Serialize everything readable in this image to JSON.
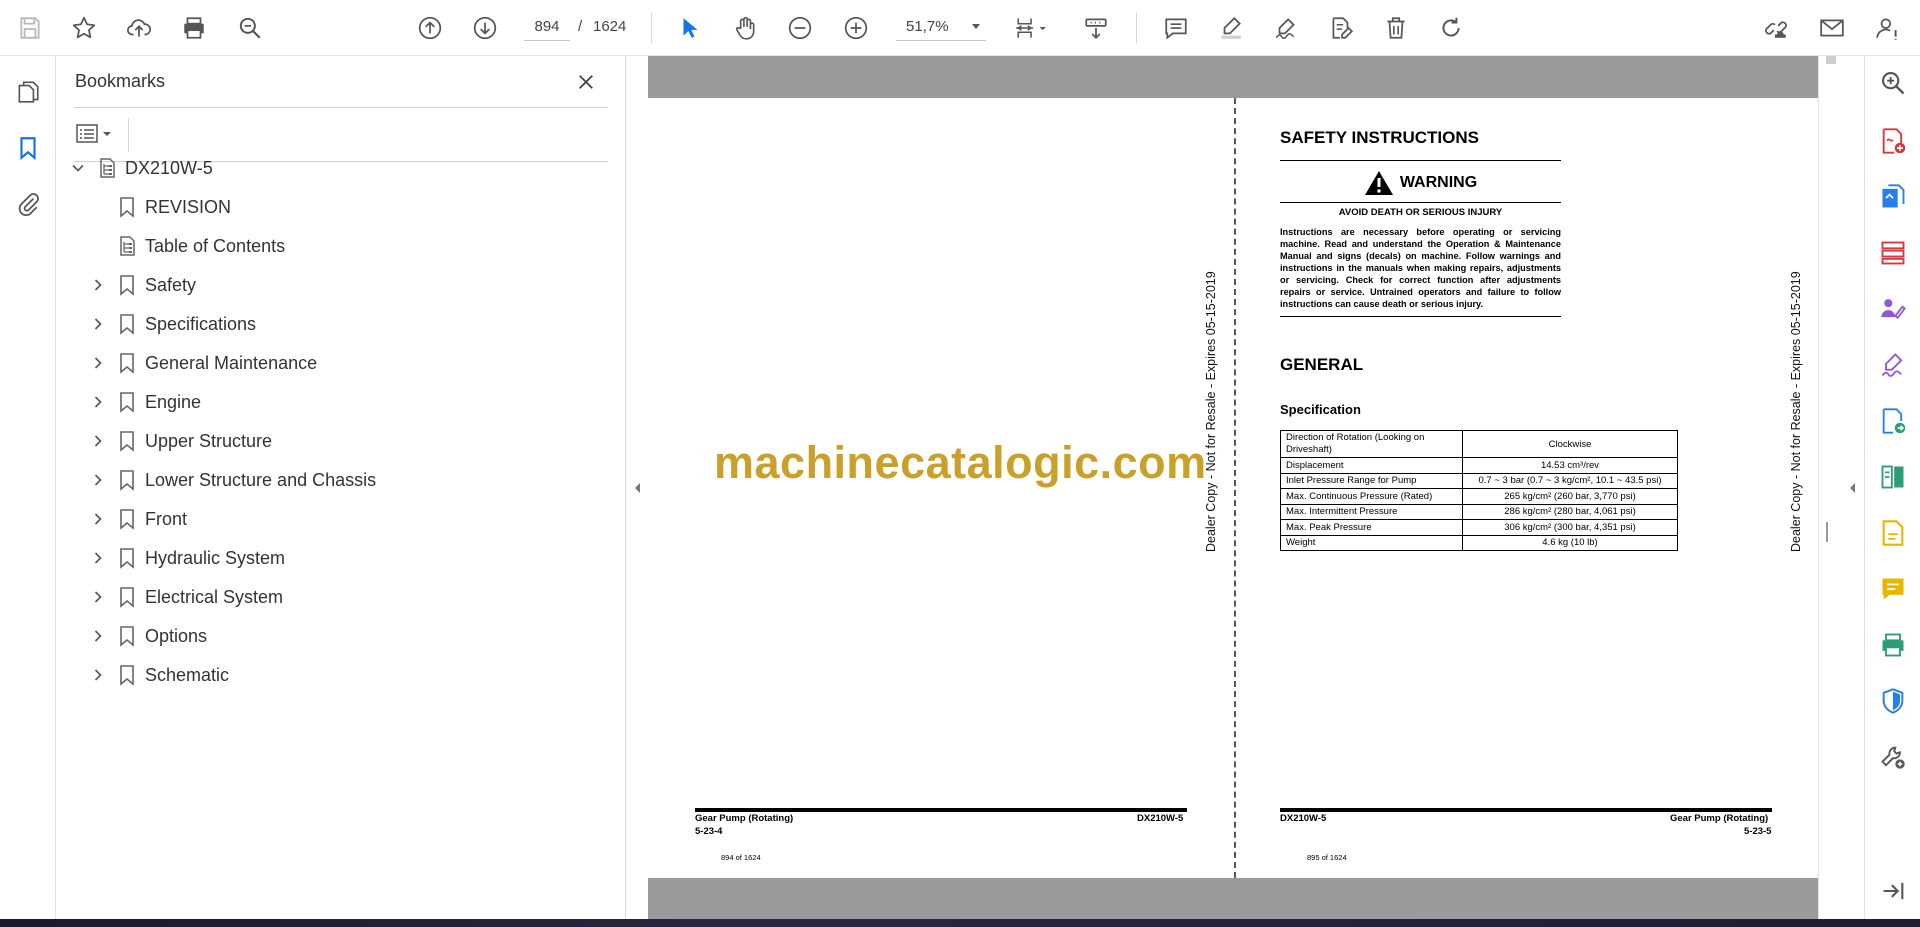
{
  "toolbar": {
    "page_current": "894",
    "page_separator": "/",
    "page_total": "1624",
    "zoom": "51,7%"
  },
  "bookmarks": {
    "title": "Bookmarks",
    "items": [
      {
        "label": "DX210W-5",
        "level": 0,
        "expanded": true
      },
      {
        "label": "REVISION",
        "level": 1,
        "has_children": false
      },
      {
        "label": "Table of Contents",
        "level": 1,
        "has_children": false
      },
      {
        "label": "Safety",
        "level": 1,
        "has_children": true
      },
      {
        "label": "Specifications",
        "level": 1,
        "has_children": true
      },
      {
        "label": "General Maintenance",
        "level": 1,
        "has_children": true
      },
      {
        "label": "Engine",
        "level": 1,
        "has_children": true
      },
      {
        "label": "Upper Structure",
        "level": 1,
        "has_children": true
      },
      {
        "label": "Lower Structure and Chassis",
        "level": 1,
        "has_children": true
      },
      {
        "label": "Front",
        "level": 1,
        "has_children": true
      },
      {
        "label": "Hydraulic System",
        "level": 1,
        "has_children": true
      },
      {
        "label": "Electrical System",
        "level": 1,
        "has_children": true
      },
      {
        "label": "Options",
        "level": 1,
        "has_children": true
      },
      {
        "label": "Schematic",
        "level": 1,
        "has_children": true
      }
    ]
  },
  "document": {
    "watermark_site": "machinecatalogic.com",
    "dealer_watermark": "Dealer Copy - Not for Resale - Expires 05-15-2019",
    "left_page": {
      "footer_left_title": "Gear Pump (Rotating)",
      "footer_left_num": "5-23-4",
      "footer_right": "DX210W-5",
      "page_count": "894 of 1624"
    },
    "right_page": {
      "safety_title": "SAFETY INSTRUCTIONS",
      "warning_label": "WARNING",
      "warning_sub": "AVOID DEATH OR SERIOUS INJURY",
      "warning_body": "Instructions are necessary before operating or servicing machine. Read and understand the Operation & Maintenance Manual and signs (decals) on machine. Follow warnings and instructions in the manuals when making repairs, adjustments or servicing. Check for correct function after adjustments repairs or service. Untrained operators and failure to follow instructions can cause death or serious injury.",
      "general_title": "GENERAL",
      "spec_title": "Specification",
      "spec_rows": [
        {
          "param": "Direction of Rotation (Looking on Driveshaft)",
          "value": "Clockwise"
        },
        {
          "param": "Displacement",
          "value": "14.53 cm³/rev"
        },
        {
          "param": "Inlet Pressure Range for Pump",
          "value": "0.7 ~ 3 bar (0.7 ~ 3 kg/cm², 10.1 ~ 43.5 psi)"
        },
        {
          "param": "Max. Continuous Pressure (Rated)",
          "value": "265 kg/cm² (260 bar, 3,770 psi)"
        },
        {
          "param": "Max. Intermittent Pressure",
          "value": "286 kg/cm² (280 bar, 4,061 psi)"
        },
        {
          "param": "Max. Peak Pressure",
          "value": "306 kg/cm² (300 bar, 4,351 psi)"
        },
        {
          "param": "Weight",
          "value": "4.6 kg (10 lb)"
        }
      ],
      "footer_left": "DX210W-5",
      "footer_right_title": "Gear Pump (Rotating)",
      "footer_right_num": "5-23-5",
      "page_count": "895 of 1624"
    }
  },
  "colors": {
    "accent_blue": "#1473e6",
    "watermark_gold": "#c9a12a",
    "tool_pink": "#d7373f",
    "tool_blue": "#2680eb",
    "tool_purple": "#9256d9",
    "tool_green": "#2d9d78",
    "tool_yellow": "#e8b600"
  }
}
